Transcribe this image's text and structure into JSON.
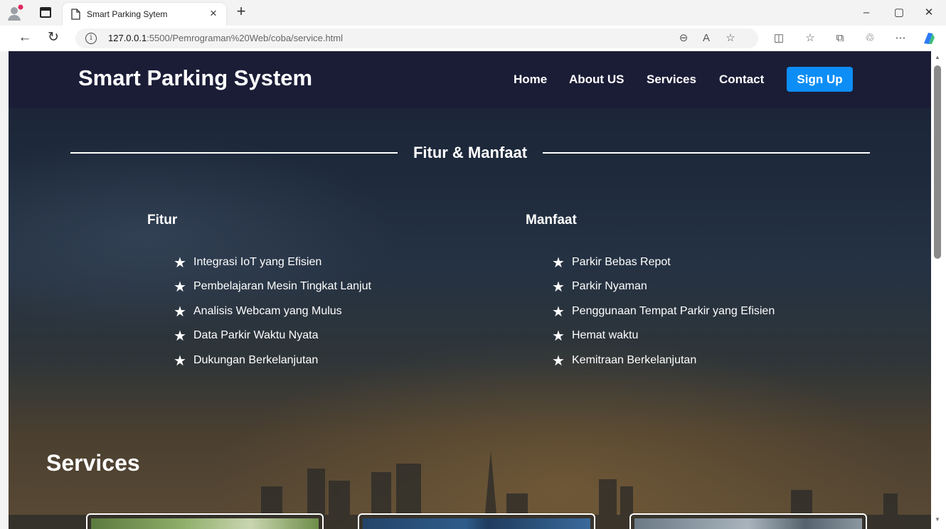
{
  "browser": {
    "tab_title": "Smart Parking Sytem",
    "url_host": "127.0.0.1",
    "url_rest": ":5500/Pemrograman%20Web/coba/service.html",
    "window_controls": [
      "–",
      "▢",
      "✕"
    ]
  },
  "header": {
    "brand": "Smart Parking System",
    "nav": [
      "Home",
      "About US",
      "Services",
      "Contact"
    ],
    "signup": "Sign Up"
  },
  "features": {
    "title": "Fitur & Manfaat",
    "fitur": {
      "title": "Fitur",
      "items": [
        "Integrasi IoT yang Efisien",
        "Pembelajaran Mesin Tingkat Lanjut",
        "Analisis Webcam yang Mulus",
        "Data Parkir Waktu Nyata",
        "Dukungan Berkelanjutan"
      ]
    },
    "manfaat": {
      "title": "Manfaat",
      "items": [
        "Parkir Bebas Repot",
        "Parkir Nyaman",
        "Penggunaan Tempat Parkir yang Efisien",
        "Hemat waktu",
        "Kemitraan Berkelanjutan"
      ]
    }
  },
  "services": {
    "title": "Services"
  },
  "colors": {
    "header_bg": "#1b1d37",
    "signup_bg": "#0d8ef7"
  },
  "icons": {
    "bullet": "star-icon"
  }
}
